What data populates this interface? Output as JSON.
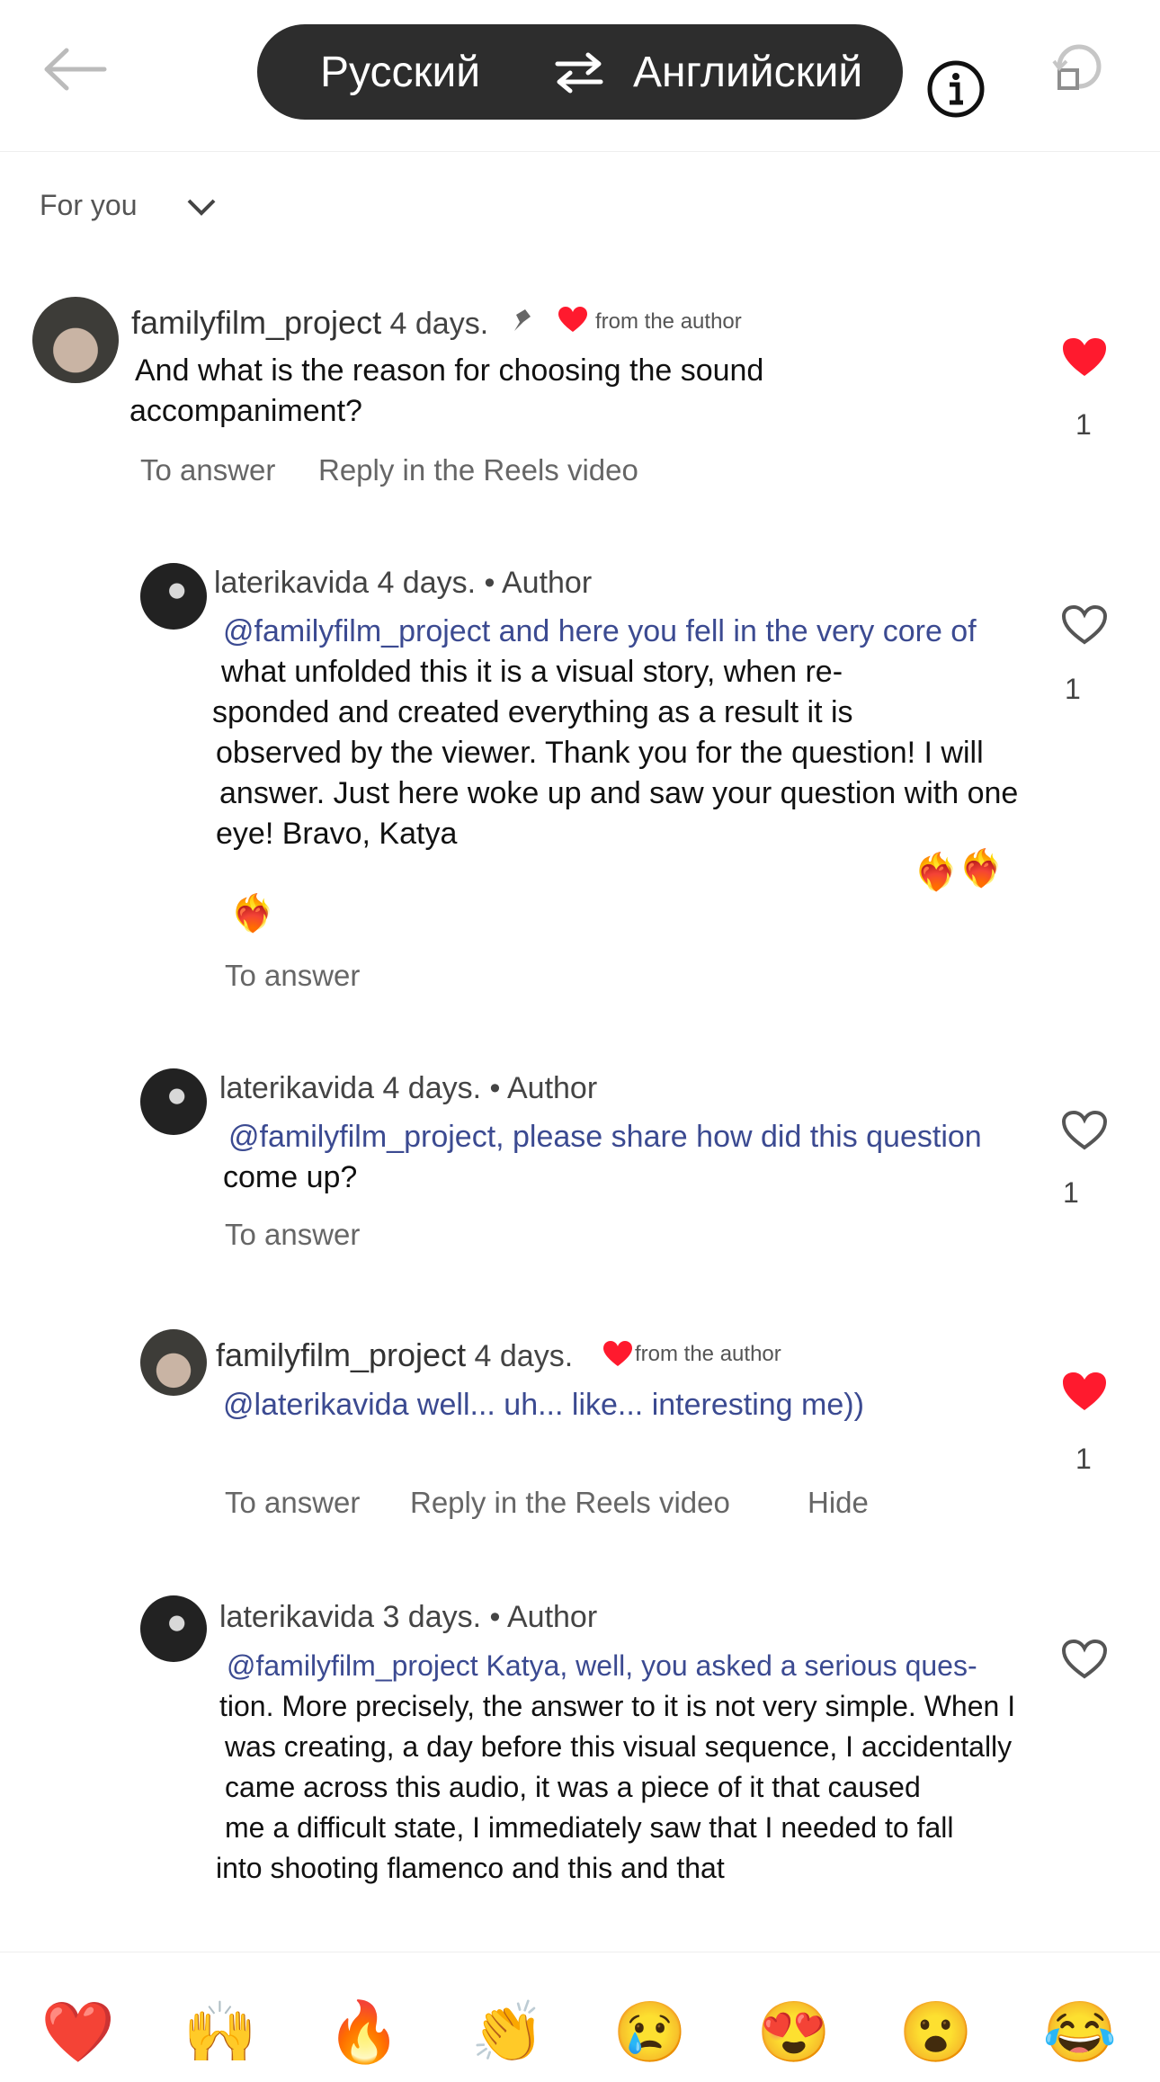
{
  "header": {
    "source_language": "Русский",
    "target_language": "Английский"
  },
  "sort": {
    "label": "For you"
  },
  "comments": [
    {
      "username": "familyfilm_project",
      "time": "4 days.",
      "badge": "from the author",
      "text_lines": [
        "And what is the reason for choosing the sound",
        "accompaniment?"
      ],
      "likes": "1",
      "liked": true,
      "actions": [
        "To answer",
        "Reply in the Reels video"
      ]
    },
    {
      "username": "laterikavida",
      "time": "4 days.",
      "author_tag": "• Author",
      "mention": "@familyfilm_project and here you fell in the very core of",
      "text_lines": [
        "what unfolded this it is a visual story, when re-",
        "sponded and created everything as a result it is",
        "observed by the viewer. Thank you for the question! I will",
        "answer. Just here woke up and saw your question with one",
        "eye!  Bravo,  Katya"
      ],
      "emoji_a": "❤️‍🔥",
      "emoji_b": "❤️‍🔥",
      "emoji_c": "❤️‍🔥",
      "likes": "1",
      "liked": false,
      "actions": [
        "To answer"
      ]
    },
    {
      "username": "laterikavida",
      "time": "4 days.",
      "author_tag": "• Author",
      "mention": "@familyfilm_project, please share how did this question",
      "text_lines": [
        "come  up?"
      ],
      "likes": "1",
      "liked": false,
      "actions": [
        "To answer"
      ]
    },
    {
      "username": "familyfilm_project",
      "time": "4 days.",
      "badge": "from the author",
      "mention": "@laterikavida well... uh... like... interesting me))",
      "likes": "1",
      "liked": true,
      "actions": [
        "To answer",
        "Reply in the Reels video",
        "Hide"
      ]
    },
    {
      "username": "laterikavida",
      "time": "3 days.",
      "author_tag": "• Author",
      "mention": "@familyfilm_project Katya, well, you asked a serious ques-",
      "text_lines": [
        "tion. More precisely, the answer to it is not very simple. When I",
        "was creating, a day before this visual sequence, I accidentally",
        "came across this audio, it was a piece of it that caused",
        "me a difficult state, I immediately saw that I needed to fall",
        "into shooting flamenco and this and that"
      ],
      "liked": false
    }
  ],
  "reactions": [
    "❤️",
    "🙌",
    "🔥",
    "👏",
    "😢",
    "😍",
    "😮",
    "😂"
  ],
  "colors": {
    "heart_red": "#ff1a2e",
    "mention_blue": "#3b4a91",
    "pill": "#2d2d2d"
  }
}
